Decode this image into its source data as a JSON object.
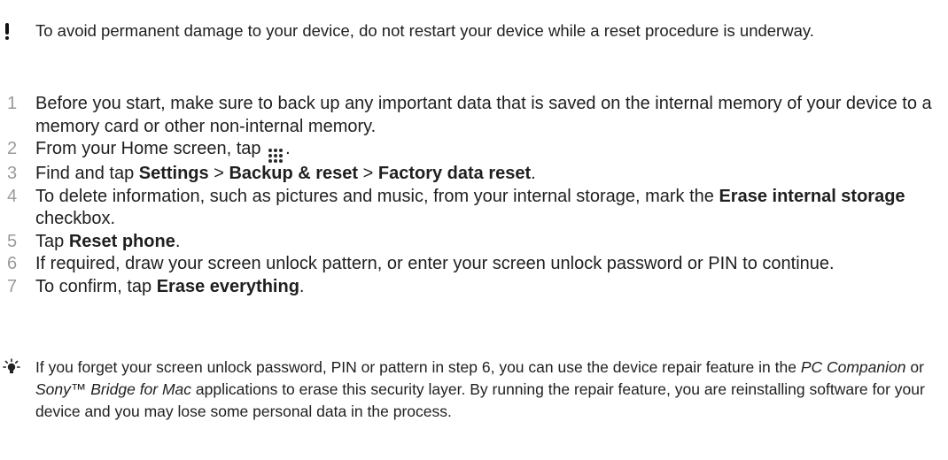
{
  "warning": {
    "icon": "exclamation-icon",
    "text": "To avoid permanent damage to your device, do not restart your device while a reset procedure is underway."
  },
  "steps": [
    {
      "num": "1",
      "parts": [
        {
          "t": "Before you start, make sure to back up any important data that is saved on the internal memory of your device to a memory card or other non-internal memory."
        }
      ]
    },
    {
      "num": "2",
      "parts": [
        {
          "t": "From your Home screen, tap "
        },
        {
          "icon": "apps-grid-icon"
        },
        {
          "t": "."
        }
      ]
    },
    {
      "num": "3",
      "parts": [
        {
          "t": "Find and tap "
        },
        {
          "b": "Settings"
        },
        {
          "t": " > "
        },
        {
          "b": "Backup & reset"
        },
        {
          "t": " > "
        },
        {
          "b": "Factory data reset"
        },
        {
          "t": "."
        }
      ]
    },
    {
      "num": "4",
      "parts": [
        {
          "t": "To delete information, such as pictures and music, from your internal storage, mark the "
        },
        {
          "b": "Erase internal storage"
        },
        {
          "t": " checkbox."
        }
      ]
    },
    {
      "num": "5",
      "parts": [
        {
          "t": "Tap "
        },
        {
          "b": "Reset phone"
        },
        {
          "t": "."
        }
      ]
    },
    {
      "num": "6",
      "parts": [
        {
          "t": "If required, draw your screen unlock pattern, or enter your screen unlock password or PIN to continue."
        }
      ]
    },
    {
      "num": "7",
      "parts": [
        {
          "t": "To confirm, tap "
        },
        {
          "b": "Erase everything"
        },
        {
          "t": "."
        }
      ]
    }
  ],
  "tip": {
    "icon": "lightbulb-tip-icon",
    "parts": [
      {
        "t": "If you forget your screen unlock password, PIN or pattern in step 6, you can use the device repair feature in the "
      },
      {
        "i": "PC Companion"
      },
      {
        "t": " or "
      },
      {
        "i": "Sony™ Bridge for Mac"
      },
      {
        "t": " applications to erase this security layer. By running the repair feature, you are reinstalling software for your device and you may lose some personal data in the process."
      }
    ]
  }
}
